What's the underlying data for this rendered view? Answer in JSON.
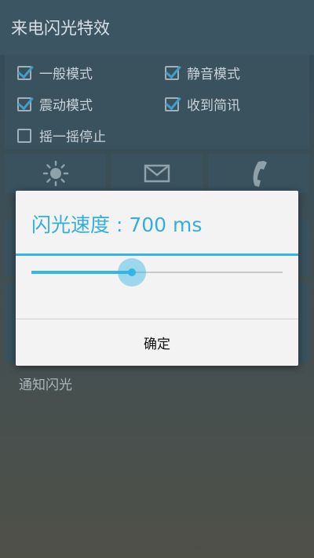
{
  "app": {
    "title": "来电闪光特效",
    "options": [
      {
        "label": "一般模式",
        "checked": true
      },
      {
        "label": "静音模式",
        "checked": true
      },
      {
        "label": "震动模式",
        "checked": true
      },
      {
        "label": "收到简讯",
        "checked": true
      },
      {
        "label": "摇一摇停止",
        "checked": false
      }
    ],
    "tiles": [
      {
        "icon": "sun-icon"
      },
      {
        "icon": "mail-icon"
      },
      {
        "icon": "phone-icon"
      }
    ],
    "notify_label": "通知闪光"
  },
  "dialog": {
    "title": "闪光速度 : 700 ms",
    "slider_fraction": 0.4,
    "ok_label": "确定"
  },
  "colors": {
    "accent": "#33b5e5",
    "dialog_bg": "#f3f3f3",
    "app_panel": "#3a525e"
  }
}
